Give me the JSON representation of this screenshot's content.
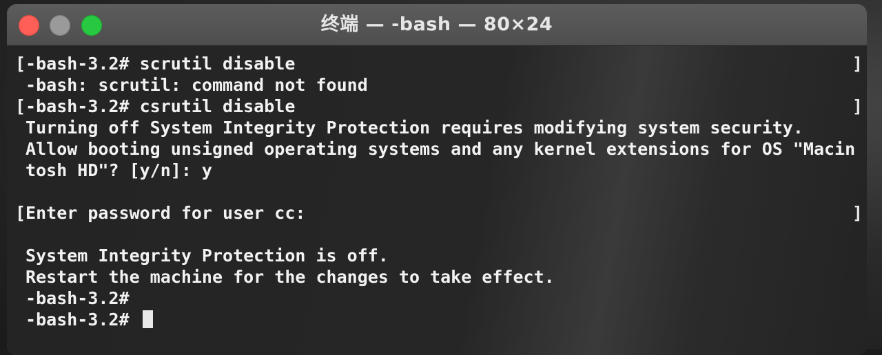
{
  "window": {
    "title": "终端 — -bash — 80×24"
  },
  "terminal": {
    "lines": [
      "[-bash-3.2# scrutil disable",
      " -bash: scrutil: command not found",
      "[-bash-3.2# csrutil disable",
      " Turning off System Integrity Protection requires modifying system security.",
      " Allow booting unsigned operating systems and any kernel extensions for OS \"Macin",
      " tosh HD\"? [y/n]: y",
      "",
      "[Enter password for user cc:",
      "",
      " System Integrity Protection is off.",
      " Restart the machine for the changes to take effect.",
      " -bash-3.2#",
      " -bash-3.2# "
    ],
    "right_brackets": [
      "]",
      "]",
      "]"
    ]
  },
  "colors": {
    "close": "#ff5f57",
    "minimize": "#9a9a9a",
    "zoom": "#28c940",
    "terminal_bg": "#262626",
    "text": "#f2f2f2"
  }
}
